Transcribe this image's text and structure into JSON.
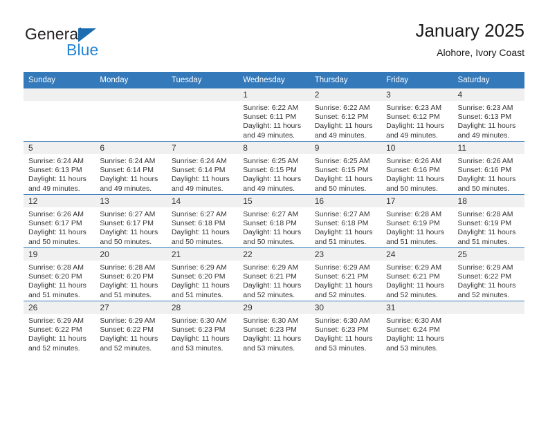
{
  "brand": {
    "name_part1": "General",
    "name_part2": "Blue",
    "triangle_icon": "triangle-icon",
    "accent_blue": "#2585d3",
    "logo_dark": "#231f20"
  },
  "header": {
    "title": "January 2025",
    "subtitle": "Alohore, Ivory Coast"
  },
  "theme": {
    "header_band": "#3479ba",
    "daynum_band": "#f0f0f0",
    "text": "#333333"
  },
  "weekdays": [
    "Sunday",
    "Monday",
    "Tuesday",
    "Wednesday",
    "Thursday",
    "Friday",
    "Saturday"
  ],
  "labels": {
    "sunrise_prefix": "Sunrise:",
    "sunset_prefix": "Sunset:",
    "daylight_prefix": "Daylight:"
  },
  "weeks": [
    [
      {
        "day": "",
        "blank": true
      },
      {
        "day": "",
        "blank": true
      },
      {
        "day": "",
        "blank": true
      },
      {
        "day": "1",
        "sunrise": "Sunrise: 6:22 AM",
        "sunset": "Sunset: 6:11 PM",
        "daylight": "Daylight: 11 hours and 49 minutes."
      },
      {
        "day": "2",
        "sunrise": "Sunrise: 6:22 AM",
        "sunset": "Sunset: 6:12 PM",
        "daylight": "Daylight: 11 hours and 49 minutes."
      },
      {
        "day": "3",
        "sunrise": "Sunrise: 6:23 AM",
        "sunset": "Sunset: 6:12 PM",
        "daylight": "Daylight: 11 hours and 49 minutes."
      },
      {
        "day": "4",
        "sunrise": "Sunrise: 6:23 AM",
        "sunset": "Sunset: 6:13 PM",
        "daylight": "Daylight: 11 hours and 49 minutes."
      }
    ],
    [
      {
        "day": "5",
        "sunrise": "Sunrise: 6:24 AM",
        "sunset": "Sunset: 6:13 PM",
        "daylight": "Daylight: 11 hours and 49 minutes."
      },
      {
        "day": "6",
        "sunrise": "Sunrise: 6:24 AM",
        "sunset": "Sunset: 6:14 PM",
        "daylight": "Daylight: 11 hours and 49 minutes."
      },
      {
        "day": "7",
        "sunrise": "Sunrise: 6:24 AM",
        "sunset": "Sunset: 6:14 PM",
        "daylight": "Daylight: 11 hours and 49 minutes."
      },
      {
        "day": "8",
        "sunrise": "Sunrise: 6:25 AM",
        "sunset": "Sunset: 6:15 PM",
        "daylight": "Daylight: 11 hours and 49 minutes."
      },
      {
        "day": "9",
        "sunrise": "Sunrise: 6:25 AM",
        "sunset": "Sunset: 6:15 PM",
        "daylight": "Daylight: 11 hours and 50 minutes."
      },
      {
        "day": "10",
        "sunrise": "Sunrise: 6:26 AM",
        "sunset": "Sunset: 6:16 PM",
        "daylight": "Daylight: 11 hours and 50 minutes."
      },
      {
        "day": "11",
        "sunrise": "Sunrise: 6:26 AM",
        "sunset": "Sunset: 6:16 PM",
        "daylight": "Daylight: 11 hours and 50 minutes."
      }
    ],
    [
      {
        "day": "12",
        "sunrise": "Sunrise: 6:26 AM",
        "sunset": "Sunset: 6:17 PM",
        "daylight": "Daylight: 11 hours and 50 minutes."
      },
      {
        "day": "13",
        "sunrise": "Sunrise: 6:27 AM",
        "sunset": "Sunset: 6:17 PM",
        "daylight": "Daylight: 11 hours and 50 minutes."
      },
      {
        "day": "14",
        "sunrise": "Sunrise: 6:27 AM",
        "sunset": "Sunset: 6:18 PM",
        "daylight": "Daylight: 11 hours and 50 minutes."
      },
      {
        "day": "15",
        "sunrise": "Sunrise: 6:27 AM",
        "sunset": "Sunset: 6:18 PM",
        "daylight": "Daylight: 11 hours and 50 minutes."
      },
      {
        "day": "16",
        "sunrise": "Sunrise: 6:27 AM",
        "sunset": "Sunset: 6:18 PM",
        "daylight": "Daylight: 11 hours and 51 minutes."
      },
      {
        "day": "17",
        "sunrise": "Sunrise: 6:28 AM",
        "sunset": "Sunset: 6:19 PM",
        "daylight": "Daylight: 11 hours and 51 minutes."
      },
      {
        "day": "18",
        "sunrise": "Sunrise: 6:28 AM",
        "sunset": "Sunset: 6:19 PM",
        "daylight": "Daylight: 11 hours and 51 minutes."
      }
    ],
    [
      {
        "day": "19",
        "sunrise": "Sunrise: 6:28 AM",
        "sunset": "Sunset: 6:20 PM",
        "daylight": "Daylight: 11 hours and 51 minutes."
      },
      {
        "day": "20",
        "sunrise": "Sunrise: 6:28 AM",
        "sunset": "Sunset: 6:20 PM",
        "daylight": "Daylight: 11 hours and 51 minutes."
      },
      {
        "day": "21",
        "sunrise": "Sunrise: 6:29 AM",
        "sunset": "Sunset: 6:20 PM",
        "daylight": "Daylight: 11 hours and 51 minutes."
      },
      {
        "day": "22",
        "sunrise": "Sunrise: 6:29 AM",
        "sunset": "Sunset: 6:21 PM",
        "daylight": "Daylight: 11 hours and 52 minutes."
      },
      {
        "day": "23",
        "sunrise": "Sunrise: 6:29 AM",
        "sunset": "Sunset: 6:21 PM",
        "daylight": "Daylight: 11 hours and 52 minutes."
      },
      {
        "day": "24",
        "sunrise": "Sunrise: 6:29 AM",
        "sunset": "Sunset: 6:21 PM",
        "daylight": "Daylight: 11 hours and 52 minutes."
      },
      {
        "day": "25",
        "sunrise": "Sunrise: 6:29 AM",
        "sunset": "Sunset: 6:22 PM",
        "daylight": "Daylight: 11 hours and 52 minutes."
      }
    ],
    [
      {
        "day": "26",
        "sunrise": "Sunrise: 6:29 AM",
        "sunset": "Sunset: 6:22 PM",
        "daylight": "Daylight: 11 hours and 52 minutes."
      },
      {
        "day": "27",
        "sunrise": "Sunrise: 6:29 AM",
        "sunset": "Sunset: 6:22 PM",
        "daylight": "Daylight: 11 hours and 52 minutes."
      },
      {
        "day": "28",
        "sunrise": "Sunrise: 6:30 AM",
        "sunset": "Sunset: 6:23 PM",
        "daylight": "Daylight: 11 hours and 53 minutes."
      },
      {
        "day": "29",
        "sunrise": "Sunrise: 6:30 AM",
        "sunset": "Sunset: 6:23 PM",
        "daylight": "Daylight: 11 hours and 53 minutes."
      },
      {
        "day": "30",
        "sunrise": "Sunrise: 6:30 AM",
        "sunset": "Sunset: 6:23 PM",
        "daylight": "Daylight: 11 hours and 53 minutes."
      },
      {
        "day": "31",
        "sunrise": "Sunrise: 6:30 AM",
        "sunset": "Sunset: 6:24 PM",
        "daylight": "Daylight: 11 hours and 53 minutes."
      },
      {
        "day": "",
        "blank": true
      }
    ]
  ]
}
